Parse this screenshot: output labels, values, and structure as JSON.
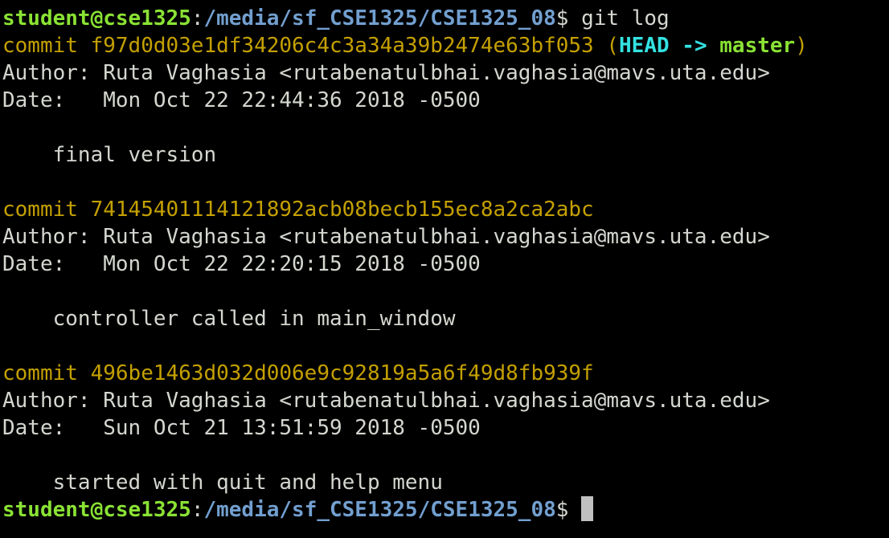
{
  "terminal": {
    "prompt1": {
      "user_host": "student@cse1325",
      "colon": ":",
      "path": "/media/sf_CSE1325/CSE1325_08",
      "symbol": "$ ",
      "command": "git log"
    },
    "commits": [
      {
        "label": "commit ",
        "hash": "f97d0d03e1df34206c4c3a34a39b2474e63bf053",
        "ref_open": " (",
        "head": "HEAD",
        "arrow": " -> ",
        "branch": "master",
        "ref_close": ")",
        "author_line": "Author: Ruta Vaghasia <rutabenatulbhai.vaghasia@mavs.uta.edu>",
        "date_line": "Date:   Mon Oct 22 22:44:36 2018 -0500",
        "message": "    final version"
      },
      {
        "label": "commit ",
        "hash": "74145401114121892acb08becb155ec8a2ca2abc",
        "author_line": "Author: Ruta Vaghasia <rutabenatulbhai.vaghasia@mavs.uta.edu>",
        "date_line": "Date:   Mon Oct 22 22:20:15 2018 -0500",
        "message": "    controller called in main_window"
      },
      {
        "label": "commit ",
        "hash": "496be1463d032d006e9c92819a5a6f49d8fb939f",
        "author_line": "Author: Ruta Vaghasia <rutabenatulbhai.vaghasia@mavs.uta.edu>",
        "date_line": "Date:   Sun Oct 21 13:51:59 2018 -0500",
        "message": "    started with quit and help menu"
      }
    ],
    "prompt2": {
      "user_host": "student@cse1325",
      "colon": ":",
      "path": "/media/sf_CSE1325/CSE1325_08",
      "symbol": "$ "
    }
  },
  "colors": {
    "background": "#000000",
    "foreground": "#d3d7cf",
    "prompt_user": "#8ae234",
    "prompt_path": "#729fcf",
    "commit": "#c4a000",
    "head_ref": "#34e2e2",
    "branch": "#8ae234"
  }
}
